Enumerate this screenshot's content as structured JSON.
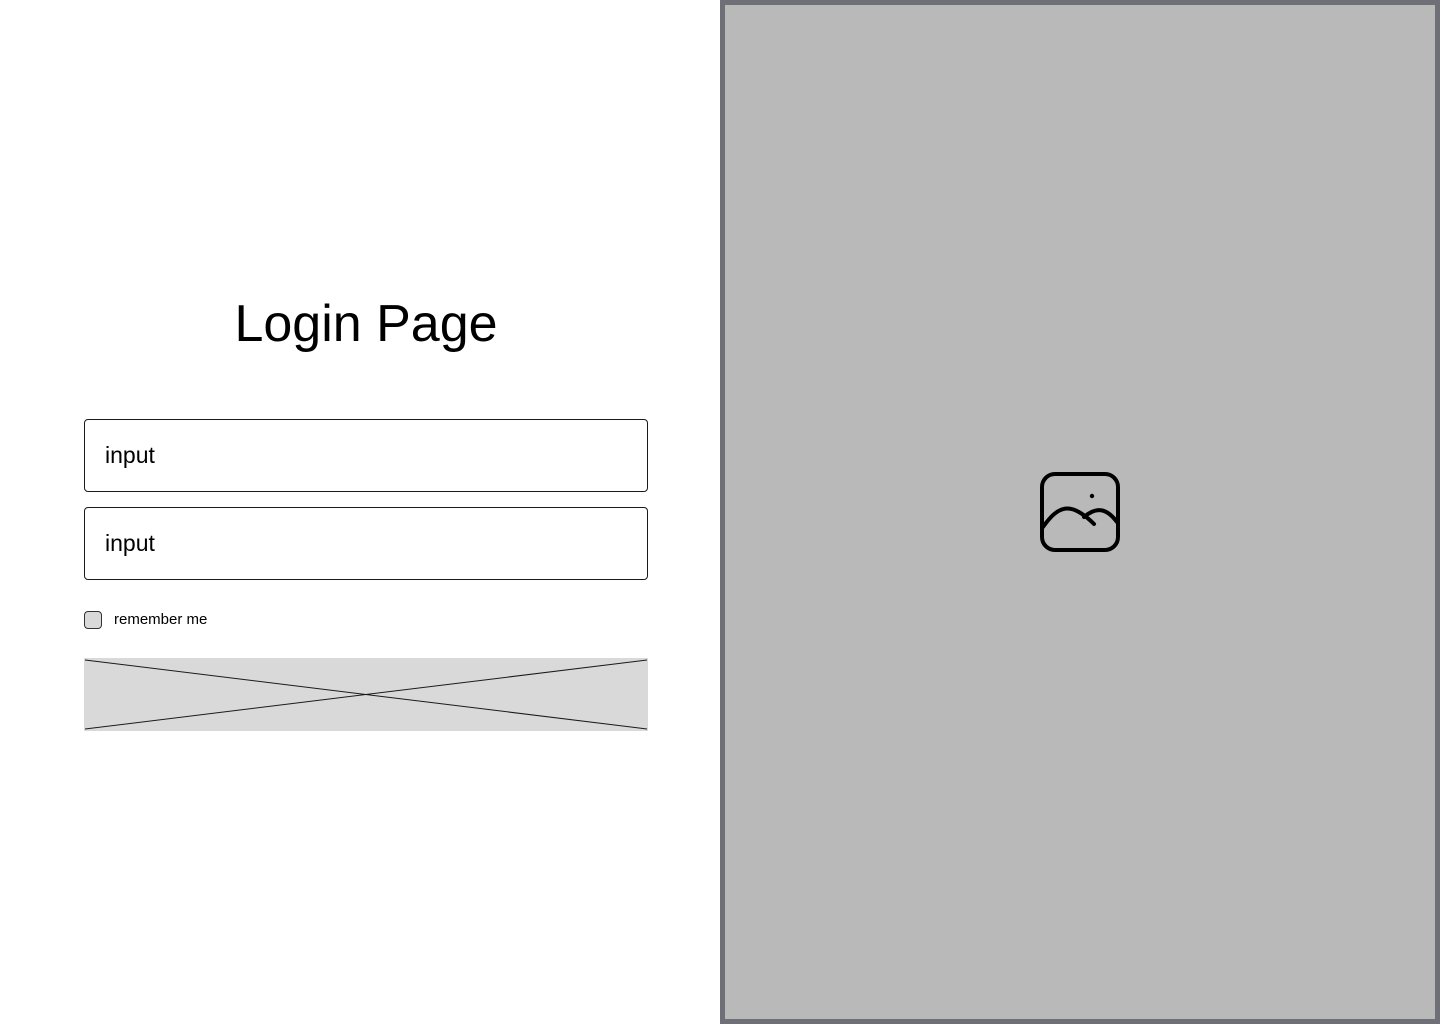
{
  "title": "Login Page",
  "fields": [
    {
      "placeholder": "input"
    },
    {
      "placeholder": "input"
    }
  ],
  "remember": {
    "label": "remember me",
    "checked": false
  },
  "submit": {
    "label": ""
  },
  "hero": {
    "icon": "image-icon"
  },
  "colors": {
    "panel_background": "#b9b9b9",
    "panel_border": "#6e6f77",
    "placeholder_fill": "#d9d9d9"
  }
}
